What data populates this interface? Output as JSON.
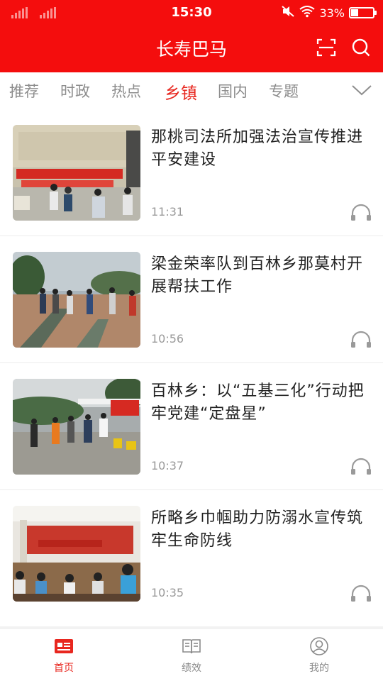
{
  "status_bar": {
    "time": "15:30",
    "battery_percent": "33%",
    "battery_level": 0.33
  },
  "header": {
    "title": "长寿巴马",
    "icons": [
      "scan-icon",
      "search-icon"
    ]
  },
  "tabs": [
    {
      "label": "推荐",
      "active": false
    },
    {
      "label": "时政",
      "active": false
    },
    {
      "label": "热点",
      "active": false
    },
    {
      "label": "乡镇",
      "active": true
    },
    {
      "label": "国内",
      "active": false
    },
    {
      "label": "专题",
      "active": false
    }
  ],
  "news": [
    {
      "title": "那桃司法所加强法治宣传推进平安建设",
      "time": "11:31"
    },
    {
      "title": "梁金荣率队到百林乡那莫村开展帮扶工作",
      "time": "10:56"
    },
    {
      "title": "百林乡：以“五基三化”行动把牢党建“定盘星”",
      "time": "10:37"
    },
    {
      "title": "所略乡巾帼助力防溺水宣传筑牢生命防线",
      "time": "10:35"
    }
  ],
  "bottom_nav": [
    {
      "label": "首页",
      "icon": "news-icon",
      "active": true
    },
    {
      "label": "绩效",
      "icon": "book-icon",
      "active": false
    },
    {
      "label": "我的",
      "icon": "profile-icon",
      "active": false
    }
  ],
  "colors": {
    "brand_red": "#f40d0d",
    "active_tab": "#e8271f"
  }
}
